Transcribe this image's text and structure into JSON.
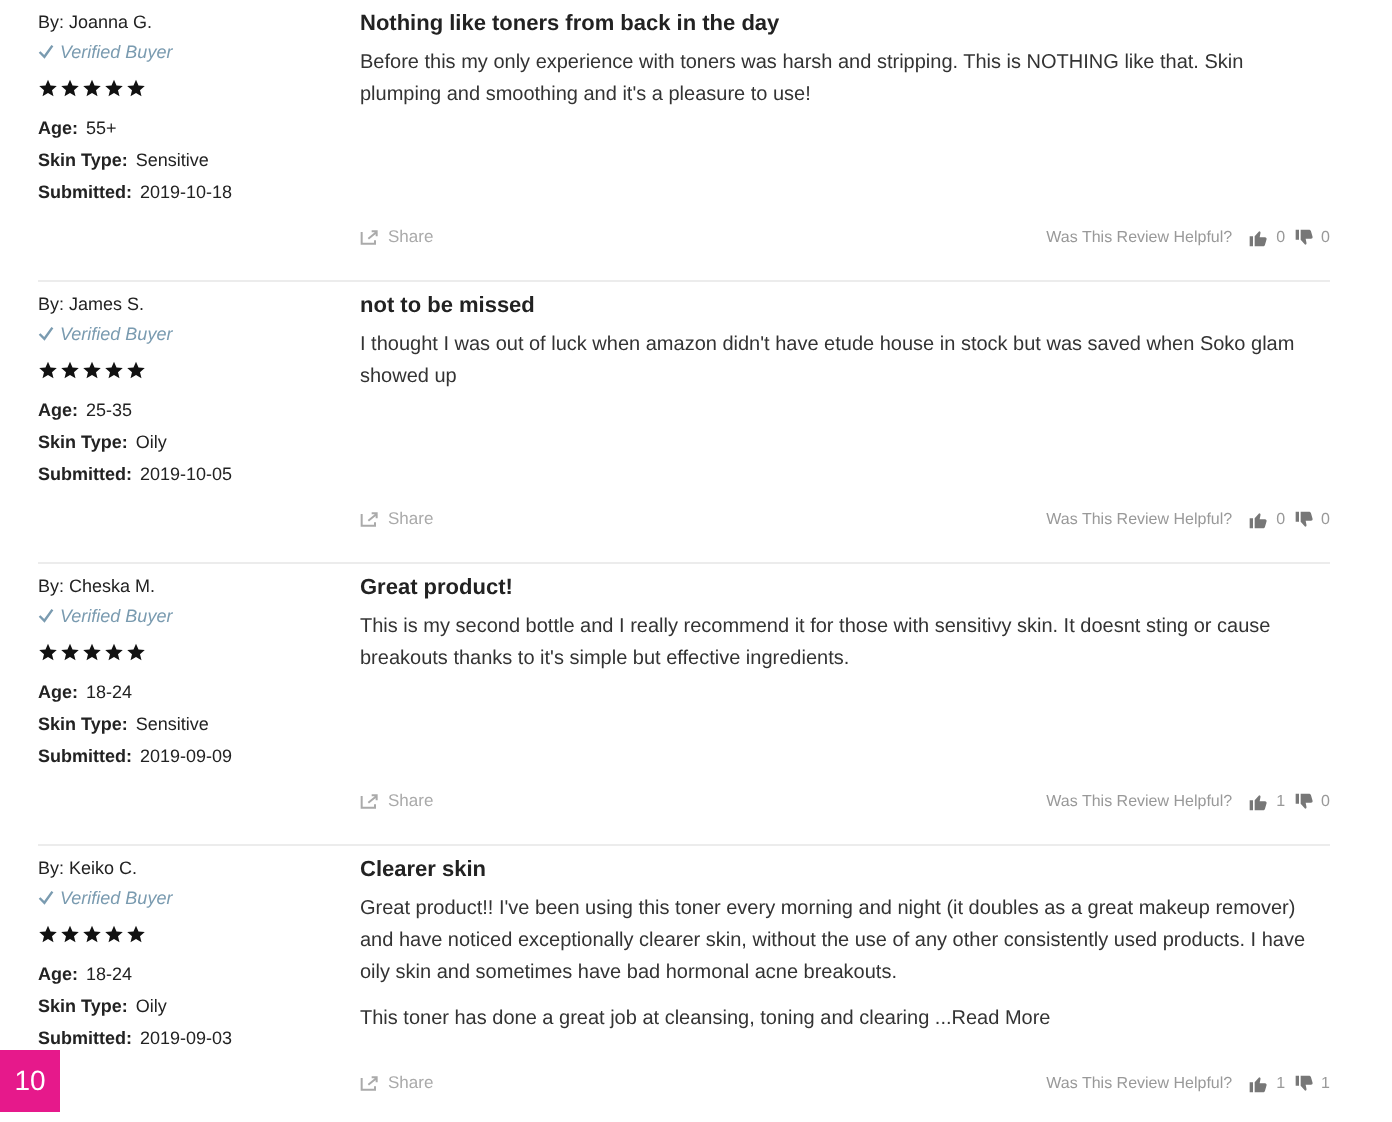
{
  "reviews": [
    {
      "author": "By: Joanna G.",
      "verified": "Verified Buyer",
      "stars": 5,
      "age_label": "Age:",
      "age": "55+",
      "skin_label": "Skin Type:",
      "skin": "Sensitive",
      "submitted_label": "Submitted:",
      "submitted": "2019-10-18",
      "title": "Nothing like toners from back in the day",
      "paragraphs": [
        "Before this my only experience with toners was harsh and stripping. This is NOTHING like that. Skin plumping and smoothing and it's a pleasure to use!"
      ],
      "share": "Share",
      "helpful": "Was This Review Helpful?",
      "up": "0",
      "down": "0"
    },
    {
      "author": "By: James S.",
      "verified": "Verified Buyer",
      "stars": 5,
      "age_label": "Age:",
      "age": "25-35",
      "skin_label": "Skin Type:",
      "skin": "Oily",
      "submitted_label": "Submitted:",
      "submitted": "2019-10-05",
      "title": "not to be missed",
      "paragraphs": [
        "I thought I was out of luck when amazon didn't have etude house in stock but was saved when Soko glam showed up"
      ],
      "share": "Share",
      "helpful": "Was This Review Helpful?",
      "up": "0",
      "down": "0"
    },
    {
      "author": "By: Cheska M.",
      "verified": "Verified Buyer",
      "stars": 5,
      "age_label": "Age:",
      "age": "18-24",
      "skin_label": "Skin Type:",
      "skin": "Sensitive",
      "submitted_label": "Submitted:",
      "submitted": "2019-09-09",
      "title": "Great product!",
      "paragraphs": [
        "This is my second bottle and I really recommend it for those with sensitivy skin. It doesnt sting or cause breakouts thanks to it's simple but effective ingredients."
      ],
      "share": "Share",
      "helpful": "Was This Review Helpful?",
      "up": "1",
      "down": "0"
    },
    {
      "author": "By: Keiko C.",
      "verified": "Verified Buyer",
      "stars": 5,
      "age_label": "Age:",
      "age": "18-24",
      "skin_label": "Skin Type:",
      "skin": "Oily",
      "submitted_label": "Submitted:",
      "submitted": "2019-09-03",
      "title": "Clearer skin",
      "paragraphs": [
        "Great product!! I've been using this toner every morning and night (it doubles as a great makeup remover) and have noticed exceptionally clearer skin, without the use of any other consistently used products. I have oily skin and sometimes have bad hormonal acne breakouts.",
        "This toner has done a great job at cleansing, toning and clearing"
      ],
      "read_more": "...Read More",
      "share": "Share",
      "helpful": "Was This Review Helpful?",
      "up": "1",
      "down": "1"
    }
  ],
  "badge": "10"
}
